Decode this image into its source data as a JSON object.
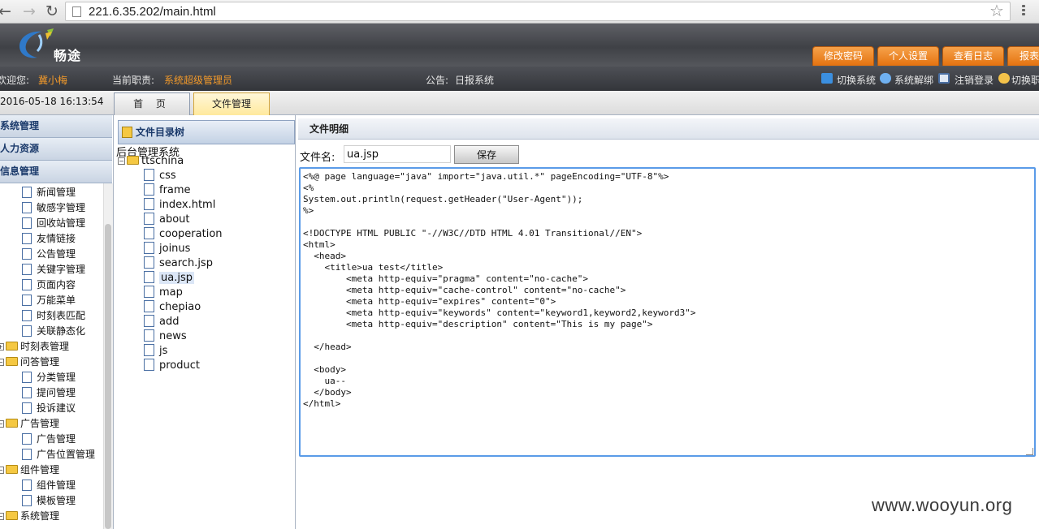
{
  "browser": {
    "url": "221.6.35.202/main.html",
    "back_icon": "arrow-left-icon",
    "forward_icon": "arrow-right-icon",
    "reload_icon": "reload-icon",
    "star_icon": "star-icon",
    "menu_icon": "menu-icon"
  },
  "header": {
    "logo_text": "畅途",
    "buttons": [
      "修改密码",
      "个人设置",
      "查看日志",
      "报表"
    ]
  },
  "infobar": {
    "welcome_label": "欢迎您:",
    "user_name": "冀小梅",
    "role_label": "当前职责:",
    "role_value": "系统超级管理员",
    "notice_label": "公告:",
    "notice_value": "日报系统",
    "actions": [
      "切换系统",
      "系统解绑",
      "注销登录",
      "切换职"
    ]
  },
  "tabs": {
    "datetime": "2016-05-18 16:13:54",
    "home": "首 页",
    "file_manage": "文件管理"
  },
  "sidebar": {
    "sections": [
      "系统管理",
      "人力资源",
      "信息管理"
    ],
    "tree": [
      {
        "label": "新闻管理",
        "type": "file",
        "level": 1
      },
      {
        "label": "敏感字管理",
        "type": "file",
        "level": 1
      },
      {
        "label": "回收站管理",
        "type": "file",
        "level": 1
      },
      {
        "label": "友情链接",
        "type": "file",
        "level": 1
      },
      {
        "label": "公告管理",
        "type": "file",
        "level": 1
      },
      {
        "label": "关键字管理",
        "type": "file",
        "level": 1
      },
      {
        "label": "页面内容",
        "type": "file",
        "level": 1
      },
      {
        "label": "万能菜单",
        "type": "file",
        "level": 1
      },
      {
        "label": "时刻表匹配",
        "type": "file",
        "level": 1
      },
      {
        "label": "关联静态化",
        "type": "file",
        "level": 1
      },
      {
        "label": "时刻表管理",
        "type": "folder",
        "level": 0,
        "toggle": "+"
      },
      {
        "label": "问答管理",
        "type": "folder",
        "level": 0,
        "toggle": "-"
      },
      {
        "label": "分类管理",
        "type": "file",
        "level": 1
      },
      {
        "label": "提问管理",
        "type": "file",
        "level": 1
      },
      {
        "label": "投诉建议",
        "type": "file",
        "level": 1
      },
      {
        "label": "广告管理",
        "type": "folder",
        "level": 0,
        "toggle": "-"
      },
      {
        "label": "广告管理",
        "type": "file",
        "level": 1
      },
      {
        "label": "广告位置管理",
        "type": "file",
        "level": 1
      },
      {
        "label": "组件管理",
        "type": "folder",
        "level": 0,
        "toggle": "-"
      },
      {
        "label": "组件管理",
        "type": "file",
        "level": 1
      },
      {
        "label": "模板管理",
        "type": "file",
        "level": 1
      },
      {
        "label": "系统管理",
        "type": "folder",
        "level": 0,
        "toggle": "-"
      }
    ]
  },
  "filetree": {
    "title": "文件目录树",
    "root": "后台管理系统",
    "folder": "ttschina",
    "items": [
      "css",
      "frame",
      "index.html",
      "about",
      "cooperation",
      "joinus",
      "search.jsp",
      "ua.jsp",
      "map",
      "chepiao",
      "add",
      "news",
      "js",
      "product"
    ],
    "selected": "ua.jsp"
  },
  "detail": {
    "title": "文件明细",
    "filename_label": "文件名:",
    "filename_value": "ua.jsp",
    "save_label": "保存",
    "code": "<%@ page language=\"java\" import=\"java.util.*\" pageEncoding=\"UTF-8\"%>\n<%\nSystem.out.println(request.getHeader(\"User-Agent\"));\n%>\n\n<!DOCTYPE HTML PUBLIC \"-//W3C//DTD HTML 4.01 Transitional//EN\">\n<html>\n  <head>\n    <title>ua test</title>\n        <meta http-equiv=\"pragma\" content=\"no-cache\">\n        <meta http-equiv=\"cache-control\" content=\"no-cache\">\n        <meta http-equiv=\"expires\" content=\"0\">\n        <meta http-equiv=\"keywords\" content=\"keyword1,keyword2,keyword3\">\n        <meta http-equiv=\"description\" content=\"This is my page\">\n\n  </head>\n\n  <body>\n    ua--\n  </body>\n</html>"
  },
  "watermark": "www.wooyun.org",
  "colors": {
    "accent_orange": "#e4720f",
    "header_dark": "#3f4146",
    "editor_border": "#5a9be8"
  }
}
